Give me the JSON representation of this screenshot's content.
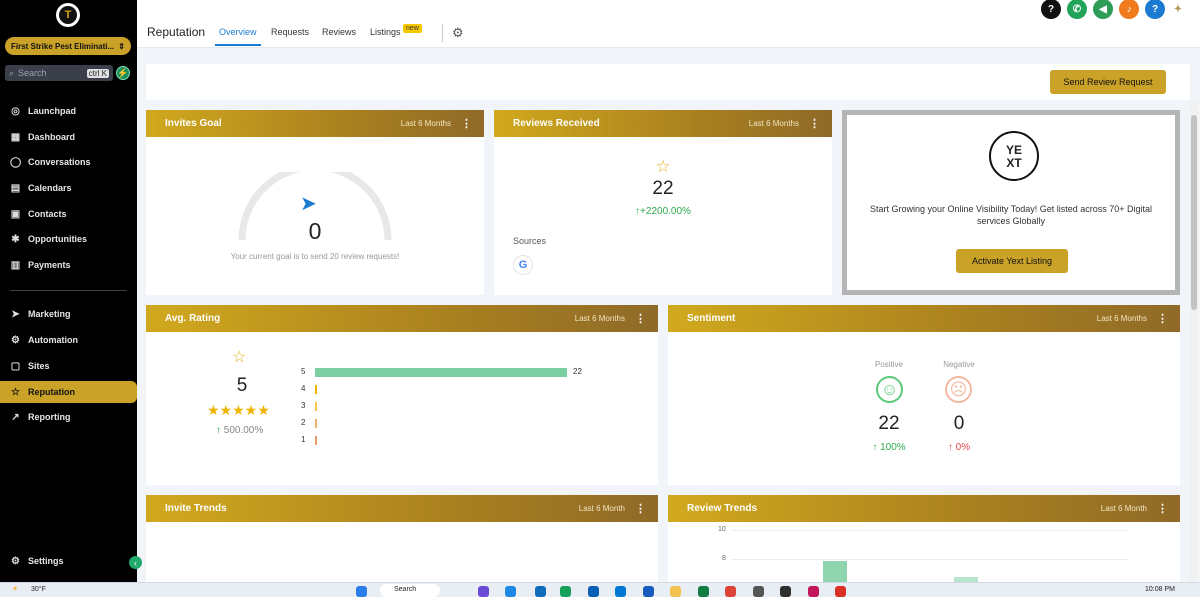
{
  "sidebar": {
    "account_name": "First Strike Pest Eliminati...",
    "search_placeholder": "Search",
    "search_shortcut": "ctrl K",
    "items": [
      {
        "label": "Launchpad",
        "icon": "rocket-icon"
      },
      {
        "label": "Dashboard",
        "icon": "grid-icon"
      },
      {
        "label": "Conversations",
        "icon": "chat-icon"
      },
      {
        "label": "Calendars",
        "icon": "calendar-icon"
      },
      {
        "label": "Contacts",
        "icon": "contacts-icon"
      },
      {
        "label": "Opportunities",
        "icon": "opportunities-icon"
      },
      {
        "label": "Payments",
        "icon": "payments-icon"
      },
      {
        "label": "Marketing",
        "icon": "send-icon"
      },
      {
        "label": "Automation",
        "icon": "automation-icon"
      },
      {
        "label": "Sites",
        "icon": "sites-icon"
      },
      {
        "label": "Reputation",
        "icon": "star-icon"
      },
      {
        "label": "Reporting",
        "icon": "chart-line-icon"
      }
    ],
    "settings_label": "Settings"
  },
  "header": {
    "title": "Reputation",
    "tabs": [
      "Overview",
      "Requests",
      "Reviews",
      "Listings"
    ],
    "new_badge": "new"
  },
  "actions": {
    "send_review_request": "Send Review Request"
  },
  "invites_goal": {
    "title": "Invites Goal",
    "period": "Last 6 Months",
    "value": "0",
    "note": "Your current goal is to send 20 review requests!"
  },
  "reviews_received": {
    "title": "Reviews Received",
    "period": "Last 6 Months",
    "value": "22",
    "change": "+2200.00%",
    "sources_label": "Sources"
  },
  "yext": {
    "logo_top": "YE",
    "logo_bottom": "XT",
    "text": "Start Growing your Online Visibility Today! Get listed across 70+ Digital services Globally",
    "button": "Activate Yext Listing"
  },
  "avg_rating": {
    "title": "Avg. Rating",
    "period": "Last 6 Months",
    "value": "5",
    "stars": 5,
    "change": "500.00%",
    "distribution": [
      {
        "star": "5",
        "count": 22,
        "label": "22"
      },
      {
        "star": "4",
        "count": 0,
        "label": ""
      },
      {
        "star": "3",
        "count": 0,
        "label": ""
      },
      {
        "star": "2",
        "count": 0,
        "label": ""
      },
      {
        "star": "1",
        "count": 0,
        "label": ""
      }
    ]
  },
  "sentiment": {
    "title": "Sentiment",
    "period": "Last 6 Months",
    "positive_label": "Positive",
    "positive_value": "22",
    "positive_change": "100%",
    "negative_label": "Negative",
    "negative_value": "0",
    "negative_change": "0%"
  },
  "invite_trends": {
    "title": "Invite Trends",
    "period": "Last 6 Month"
  },
  "review_trends": {
    "title": "Review Trends",
    "period": "Last 6 Month",
    "y_ticks": [
      "10",
      "8"
    ]
  },
  "taskbar": {
    "weather": "30°F",
    "search": "Search",
    "time": "10:08 PM"
  },
  "colors": {
    "brand_gold": "#c9a227",
    "positive_green": "#2daa4a",
    "negative_red": "#e04646",
    "link_blue": "#1a7bd0"
  }
}
